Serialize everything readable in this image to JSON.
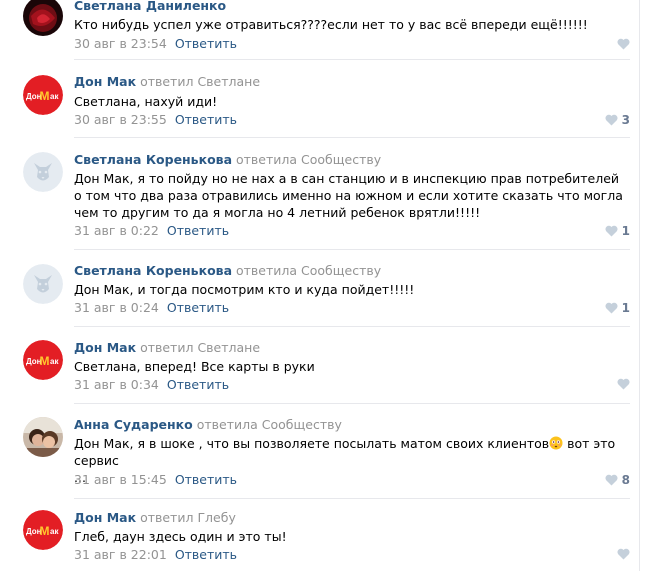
{
  "comments": [
    {
      "author": "Светлана Даниленко",
      "reply_text": "",
      "reply_to": "",
      "text": "Кто нибудь успел уже отравиться????если нет то у вас всё впереди ещё!!!!!!",
      "date": "30 авг в 23:54",
      "reply_label": "Ответить",
      "likes": "",
      "avatar": "dark-red-avatar"
    },
    {
      "author": "Дон Мак",
      "reply_text": "ответил",
      "reply_to": "Светлане",
      "text": "Светлана, нахуй иди!",
      "date": "30 авг в 23:55",
      "reply_label": "Ответить",
      "likes": "3",
      "avatar": "donmak-logo"
    },
    {
      "author": "Светлана Коренькова",
      "reply_text": "ответила",
      "reply_to": "Сообществу",
      "text": "Дон Мак, я то пойду но не нах а в сан станцию и в инспекцию прав потребителей о том что два раза отравились именно на южном и если хотите сказать что могла чем то другим то да я могла но 4 летний ребенок врятли!!!!!",
      "date": "31 авг в 0:22",
      "reply_label": "Ответить",
      "likes": "1",
      "avatar": "default-dog-avatar"
    },
    {
      "author": "Светлана Коренькова",
      "reply_text": "ответила",
      "reply_to": "Сообществу",
      "text": "Дон Мак, и тогда посмотрим кто и куда пойдет!!!!!",
      "date": "31 авг в 0:24",
      "reply_label": "Ответить",
      "likes": "1",
      "avatar": "default-dog-avatar"
    },
    {
      "author": "Дон Мак",
      "reply_text": "ответил",
      "reply_to": "Светлане",
      "text": "Светлана, вперед! Все карты в руки",
      "date": "31 авг в 0:34",
      "reply_label": "Ответить",
      "likes": "",
      "avatar": "donmak-logo"
    },
    {
      "author": "Анна Сударенко",
      "reply_text": "ответила",
      "reply_to": "Сообществу",
      "text": "Дон Мак, я в шоке , что вы позволяете посылать матом своих клиентов",
      "text_after_emoji": " вот это сервис",
      "text_line2": "...",
      "date": "31 авг в 15:45",
      "reply_label": "Ответить",
      "likes": "8",
      "avatar": "photo-avatar"
    },
    {
      "author": "Дон Мак",
      "reply_text": "ответил",
      "reply_to": "Глебу",
      "text": "Глеб, даун здесь один и это ты!",
      "date": "31 авг в 22:01",
      "reply_label": "Ответить",
      "likes": "",
      "avatar": "donmak-logo"
    }
  ],
  "logo_text": {
    "left": "Дон",
    "middle": "M",
    "right": "ак"
  },
  "colors": {
    "link": "#2a5885",
    "muted": "#939393",
    "logo_red": "#e31e24",
    "logo_yellow": "#ffc72c",
    "like_icon": "#a1adbf"
  }
}
